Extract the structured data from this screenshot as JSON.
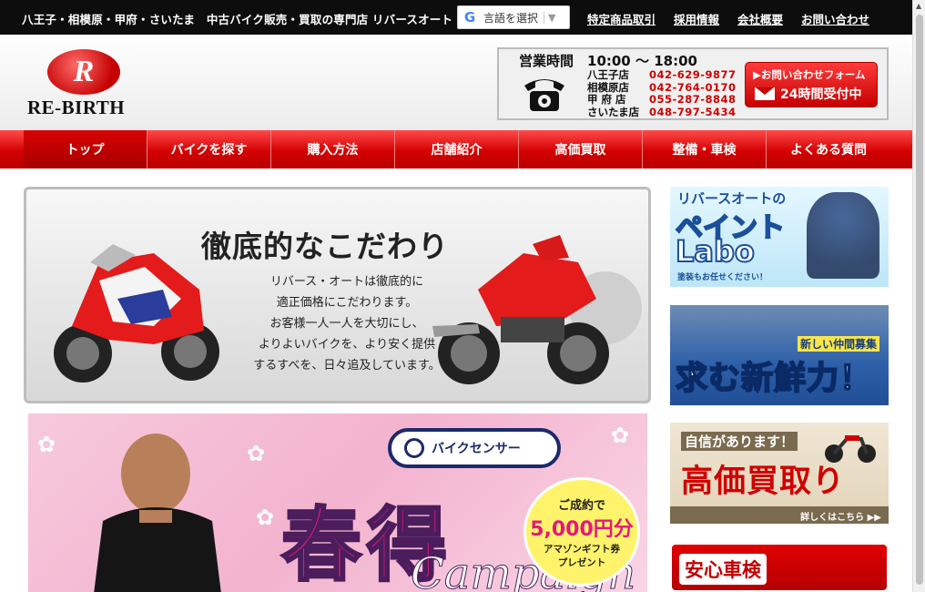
{
  "topbar": {
    "tagline": "八王子・相模原・甲府・さいたま　中古バイク販売・買取の専門店 リバースオート",
    "translate_label": "言語を選択",
    "links": [
      "特定商品取引",
      "採用情報",
      "会社概要",
      "お問い合わせ"
    ]
  },
  "logo": {
    "mark": "R",
    "text": "RE-BIRTH"
  },
  "hours": {
    "title": "営業時間　10:00 〜 18:00",
    "stores": [
      {
        "name": "八王子店",
        "tel": "042-629-9877"
      },
      {
        "name": "相模原店",
        "tel": "042-764-0170"
      },
      {
        "name": "甲 府 店",
        "tel": "055-287-8848"
      },
      {
        "name": "さいたま店",
        "tel": "048-797-5434"
      }
    ]
  },
  "contact_button": {
    "line1": "▶お問い合わせフォーム",
    "line2": "24時間受付中"
  },
  "nav": [
    "トップ",
    "バイクを探す",
    "購入方法",
    "店舗紹介",
    "高価買取",
    "整備・車検",
    "よくある質問"
  ],
  "hero": {
    "title": "徹底的なこだわり",
    "lines": [
      "リバース・オートは徹底的に",
      "適正価格にこだわります。",
      "お客様一人一人を大切にし、",
      "よりよいバイクを、より安く提供",
      "するすべを、日々追及しています。"
    ]
  },
  "campaign": {
    "badge": "バイクセンサー",
    "big_text": "春得",
    "script_text": "Campaign",
    "circle": [
      "ご成約で",
      "5,000円分",
      "アマゾンギフト券",
      "プレゼント"
    ]
  },
  "sidebar": {
    "paint": {
      "line1": "リバースオートの",
      "line2": "ペイント",
      "line3": "Labo",
      "line4": "塗装もお任せください！"
    },
    "recruit": {
      "line1": "新しい仲間募集",
      "line2": "求む新鮮力！"
    },
    "buy": {
      "line1": "自信があります！",
      "line2": "高価買取り",
      "more": "詳しくはこちら ▶▶"
    },
    "inspection": {
      "line1": "安心車検"
    }
  },
  "colors": {
    "brand_red": "#d40000",
    "topbar": "#0d0d0d",
    "tel_red": "#d00000"
  }
}
